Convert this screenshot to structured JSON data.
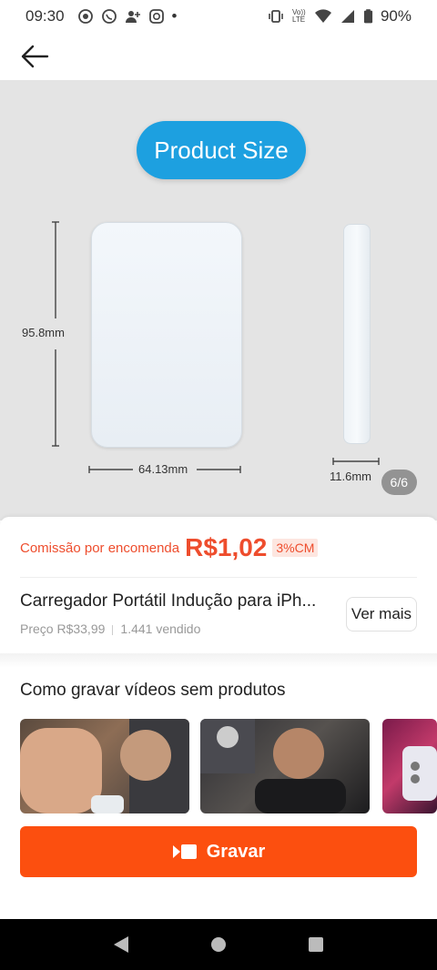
{
  "status_bar": {
    "time": "09:30",
    "dot": "•",
    "battery": "90%",
    "lte_label": "Vo)) LTE"
  },
  "gallery": {
    "pill_text": "Product Size",
    "height_dim": "95.8mm",
    "width_dim": "64.13mm",
    "depth_dim": "11.6mm",
    "page_counter": "6/6"
  },
  "product": {
    "commission_label": "Comissão por encomenda",
    "commission_value": "R$1,02",
    "commission_badge": "3%CM",
    "title": "Carregador Portátil Indução para iPh...",
    "price": "Preço R$33,99",
    "sold": "1.441 vendido",
    "ver_mais": "Ver mais"
  },
  "videos": {
    "section_title": "Como gravar vídeos sem produtos"
  },
  "actions": {
    "gravar_label": "Gravar"
  },
  "colors": {
    "accent": "#ee4d2d",
    "button": "#fc4f0f",
    "pill": "#1da0e0"
  }
}
